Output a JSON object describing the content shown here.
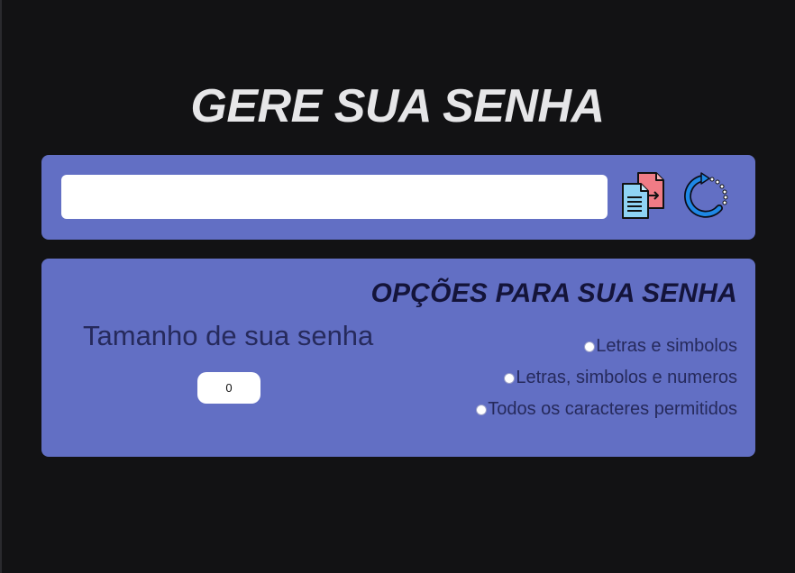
{
  "header": {
    "title": "GERE SUA SENHA"
  },
  "generator": {
    "password_value": "",
    "copy_icon": "copy-document-icon",
    "refresh_icon": "refresh-icon"
  },
  "options": {
    "title": "OPÇÕES PARA SUA SENHA",
    "length_label": "Tamanho de sua senha",
    "length_value": "0",
    "choices": [
      {
        "label": "Letras e simbolos",
        "selected": false
      },
      {
        "label": "Letras, simbolos e numeros",
        "selected": false
      },
      {
        "label": "Todos os caracteres permitidos",
        "selected": false
      }
    ]
  },
  "colors": {
    "background": "#121214",
    "panel": "#626fc4",
    "title": "#e6e6e8",
    "text_dark": "#262a5c"
  }
}
